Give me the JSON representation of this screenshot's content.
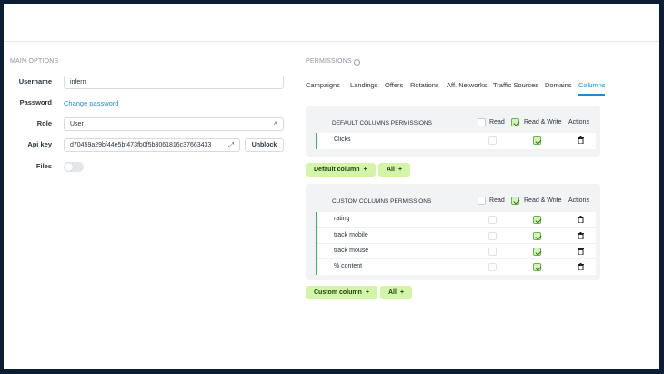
{
  "main_options": {
    "title": "MAIN OPTIONS",
    "username_label": "Username",
    "username_value": "infern",
    "password_label": "Password",
    "change_password": "Change password",
    "role_label": "Role",
    "role_value": "User",
    "apikey_label": "Api key",
    "apikey_value": "d70459a29bf44e5bf473fb0f5b3061816c37663433",
    "unblock_label": "Unblock",
    "files_label": "Files"
  },
  "permissions": {
    "title": "PERMISSIONS",
    "help_icon": "?",
    "tabs": [
      "Campaigns",
      "Landings",
      "Offers",
      "Rotations",
      "Aff. Networks",
      "Traffic Sources",
      "Domains",
      "Columns"
    ],
    "active_tab": "Columns",
    "default_panel": {
      "title": "DEFAULT COLUMNS PERMISSIONS",
      "read": "Read",
      "read_write": "Read & Write",
      "actions": "Actions",
      "rows": [
        {
          "label": "Clicks"
        }
      ],
      "add_label": "Default column",
      "all_label": "All"
    },
    "custom_panel": {
      "title": "CUSTOM COLUMNS PERMISSIONS",
      "read": "Read",
      "read_write": "Read & Write",
      "actions": "Actions",
      "rows": [
        {
          "label": "rating"
        },
        {
          "label": "track mobile"
        },
        {
          "label": "track mouse"
        },
        {
          "label": "% content"
        }
      ],
      "add_label": "Custom column",
      "all_label": "All"
    },
    "plus": "+"
  }
}
